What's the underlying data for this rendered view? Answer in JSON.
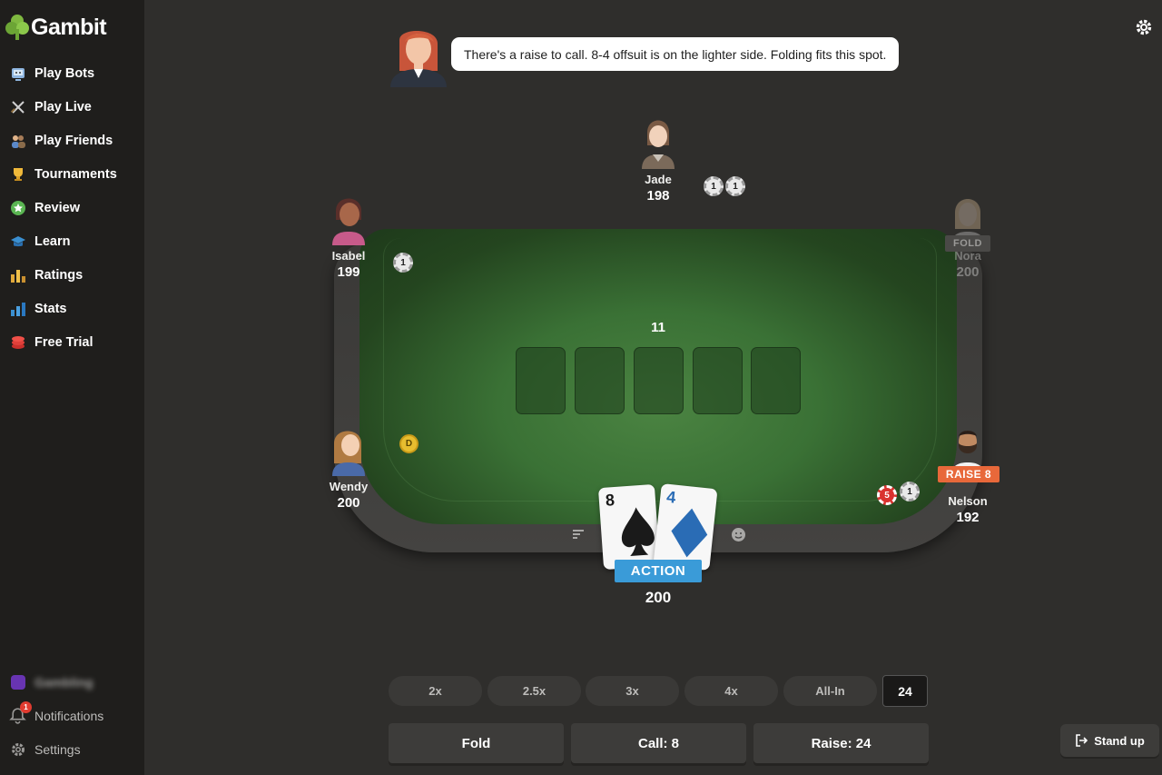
{
  "app": {
    "name": "Gambit"
  },
  "sidebar": {
    "items": [
      {
        "label": "Play Bots",
        "icon": "robot-icon"
      },
      {
        "label": "Play Live",
        "icon": "crossed-swords-icon"
      },
      {
        "label": "Play Friends",
        "icon": "friends-icon"
      },
      {
        "label": "Tournaments",
        "icon": "trophy-icon"
      },
      {
        "label": "Review",
        "icon": "star-icon"
      },
      {
        "label": "Learn",
        "icon": "graduation-cap-icon"
      },
      {
        "label": "Ratings",
        "icon": "ratings-bars-icon"
      },
      {
        "label": "Stats",
        "icon": "stats-chart-icon"
      },
      {
        "label": "Free Trial",
        "icon": "chip-stack-icon"
      }
    ],
    "bottom": {
      "username": "Gambling",
      "notifications_label": "Notifications",
      "notifications_count": "1",
      "settings_label": "Settings"
    }
  },
  "coach": {
    "message": "There's a raise to call. 8-4 offsuit is on the lighter side. Folding fits this spot."
  },
  "table": {
    "pot": "11",
    "players": {
      "jade": {
        "name": "Jade",
        "stack": "198",
        "chips": [
          "1",
          "1"
        ]
      },
      "isabel": {
        "name": "Isabel",
        "stack": "199",
        "chips": [
          "1"
        ]
      },
      "nora": {
        "name": "Nora",
        "stack": "200",
        "status": "FOLD"
      },
      "wendy": {
        "name": "Wendy",
        "stack": "200",
        "dealer": "D"
      },
      "nelson": {
        "name": "Nelson",
        "stack": "192",
        "status": "RAISE 8",
        "chips": [
          "5",
          "1"
        ]
      }
    },
    "hero": {
      "cards": [
        {
          "rank": "8",
          "suit": "spade",
          "color": "#1a1a1a"
        },
        {
          "rank": "4",
          "suit": "diamond",
          "color": "#2a6cb5"
        }
      ],
      "badge": "ACTION",
      "stack": "200"
    }
  },
  "bet_sizing": {
    "presets": [
      "2x",
      "2.5x",
      "3x",
      "4x",
      "All-In"
    ],
    "amount": "24"
  },
  "actions": {
    "fold": "Fold",
    "call": "Call: 8",
    "raise": "Raise: 24"
  },
  "stand_up": "Stand up",
  "colors": {
    "background": "#2f2e2c",
    "sidebar": "#1f1e1c",
    "felt": "#3a7135",
    "action_blue": "#3a9bd8",
    "raise_orange": "#e8683a"
  }
}
